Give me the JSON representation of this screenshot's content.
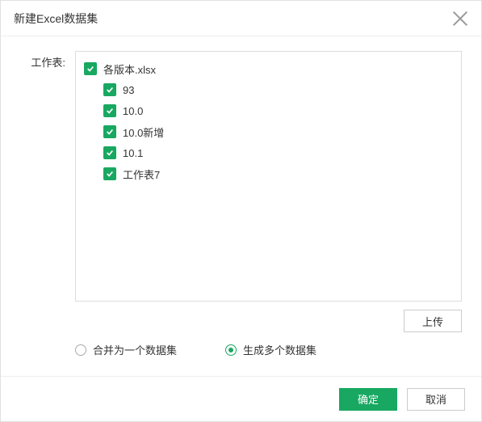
{
  "dialog": {
    "title": "新建Excel数据集"
  },
  "form": {
    "worksheet_label": "工作表:"
  },
  "tree": {
    "root": {
      "label": "各版本.xlsx",
      "checked": true
    },
    "items": [
      {
        "label": "93",
        "checked": true
      },
      {
        "label": "10.0",
        "checked": true
      },
      {
        "label": "10.0新增",
        "checked": true
      },
      {
        "label": "10.1",
        "checked": true
      },
      {
        "label": "工作表7",
        "checked": true
      }
    ]
  },
  "actions": {
    "upload": "上传",
    "ok": "确定",
    "cancel": "取消"
  },
  "mode": {
    "merge": "合并为一个数据集",
    "multi": "生成多个数据集",
    "selected": "multi"
  }
}
